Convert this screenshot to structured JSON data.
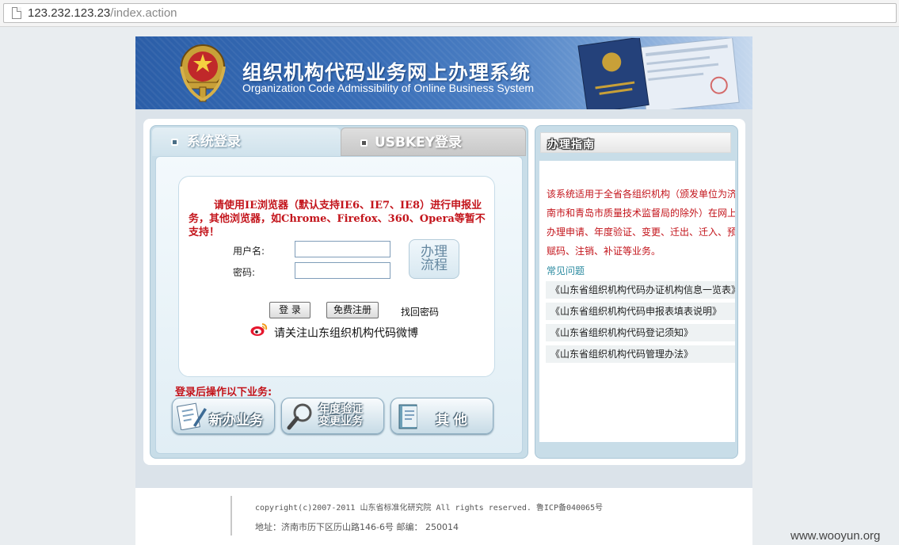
{
  "browser": {
    "url_host": "123.232.123.23",
    "url_path": "/index.action"
  },
  "banner": {
    "title_cn": "组织机构代码业务网上办理系统",
    "title_en": "Organization Code Admissibility of Online Business System",
    "brand_color": "#2b5ea8"
  },
  "login": {
    "tabs": [
      {
        "label": "系统登录",
        "icon": "square-bullet-icon"
      },
      {
        "label": "USBKEY登录",
        "icon": "square-bullet-icon"
      }
    ],
    "notice": "请使用IE浏览器（默认支持IE6、IE7、IE8）进行申报业务，其他浏览器，如Chrome、Firefox、360、Opera等暂不支持！",
    "username_label": "用户名:",
    "username_value": "",
    "password_label": "密码:",
    "password_value": "",
    "flow_button": {
      "line1": "办理",
      "line2": "流程"
    },
    "login_button": "登 录",
    "register_button": "免费注册",
    "forgot_password": "找回密码",
    "weibo_text": "请关注山东组织机构代码微博",
    "after_login_title": "登录后操作以下业务:",
    "business_buttons": [
      {
        "label": "新办业务",
        "icon": "document-pen-icon"
      },
      {
        "line1": "年度验证",
        "line2": "变更业务",
        "icon": "magnifier-icon"
      },
      {
        "label": "其 他",
        "icon": "book-icon"
      }
    ],
    "notice_color": "#c3141b"
  },
  "guide": {
    "title": "办理指南",
    "text": "该系统适用于全省各组织机构（颁发单位为济南市和青岛市质量技术监督局的除外）在网上办理申请、年度验证、变更、迁出、迁入、预赋码、注销、补证等业务。",
    "faq_title": "常见问题",
    "faq_items": [
      "《山东省组织机构代码办证机构信息一览表》",
      "《山东省组织机构代码申报表填表说明》",
      "《山东省组织机构代码登记须知》",
      "《山东省组织机构代码管理办法》"
    ]
  },
  "footer": {
    "copyright": "copyright(c)2007-2011 山东省标准化研究院 All rights reserved. 鲁ICP备040065号",
    "address": "地址：济南市历下区历山路146-6号 邮编： 250014"
  },
  "watermark": "www.wooyun.org"
}
